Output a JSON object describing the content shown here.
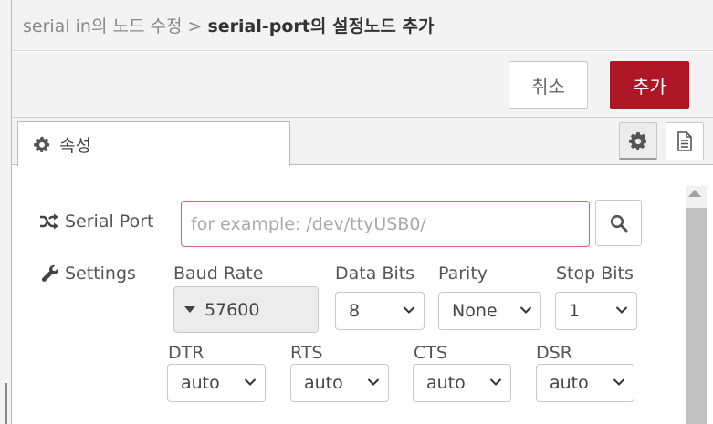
{
  "header": {
    "breadcrumb_prefix": "serial in의 노드 수정",
    "separator": ">",
    "current": "serial-port의 설정노드 추가"
  },
  "toolbar": {
    "cancel_label": "취소",
    "add_label": "추가"
  },
  "tabs": {
    "properties_label": "속성"
  },
  "form": {
    "serial_port_label": "Serial Port",
    "serial_port_placeholder": "for example: /dev/ttyUSB0/",
    "serial_port_value": "",
    "settings_label": "Settings",
    "baud_rate_label": "Baud Rate",
    "baud_rate_value": "57600",
    "data_bits_label": "Data Bits",
    "data_bits_value": "8",
    "parity_label": "Parity",
    "parity_value": "None",
    "stop_bits_label": "Stop Bits",
    "stop_bits_value": "1",
    "dtr_label": "DTR",
    "dtr_value": "auto",
    "rts_label": "RTS",
    "rts_value": "auto",
    "cts_label": "CTS",
    "cts_value": "auto",
    "dsr_label": "DSR",
    "dsr_value": "auto"
  },
  "icons": {
    "tab": "gear-icon",
    "serial_port": "shuffle-icon",
    "settings": "wrench-icon",
    "search": "search-icon",
    "properties_button": "gear-icon",
    "description_button": "document-icon"
  },
  "colors": {
    "primary_button": "#ad1625",
    "input_error_border": "#d6615f",
    "panel_background": "#f3f3f3"
  }
}
